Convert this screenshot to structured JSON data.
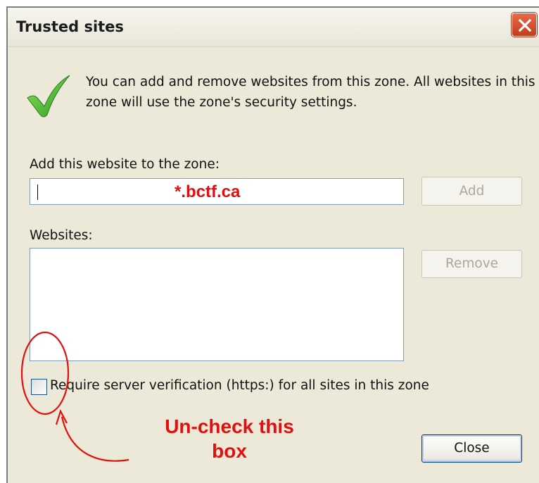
{
  "window": {
    "title": "Trusted sites",
    "close_glyph": "X"
  },
  "intro": {
    "icon": "checkmark-icon",
    "text": "You can add and remove websites from this zone. All websites in this zone will use the zone's security settings."
  },
  "add_section": {
    "label": "Add this website to the zone:",
    "input_value": "*.bctf.ca",
    "add_button": "Add"
  },
  "websites_section": {
    "label": "Websites:",
    "items": [],
    "remove_button": "Remove"
  },
  "https_option": {
    "label": "Require server verification (https:) for all sites in this zone",
    "checked": false
  },
  "footer": {
    "close_button": "Close"
  },
  "annotation": {
    "line1": "Un-check this",
    "line2": "box",
    "color": "#e01010"
  },
  "colors": {
    "dialog_bg": "#ece9d8",
    "input_border": "#7f9db9",
    "close_button_red": "#c33d1e"
  }
}
